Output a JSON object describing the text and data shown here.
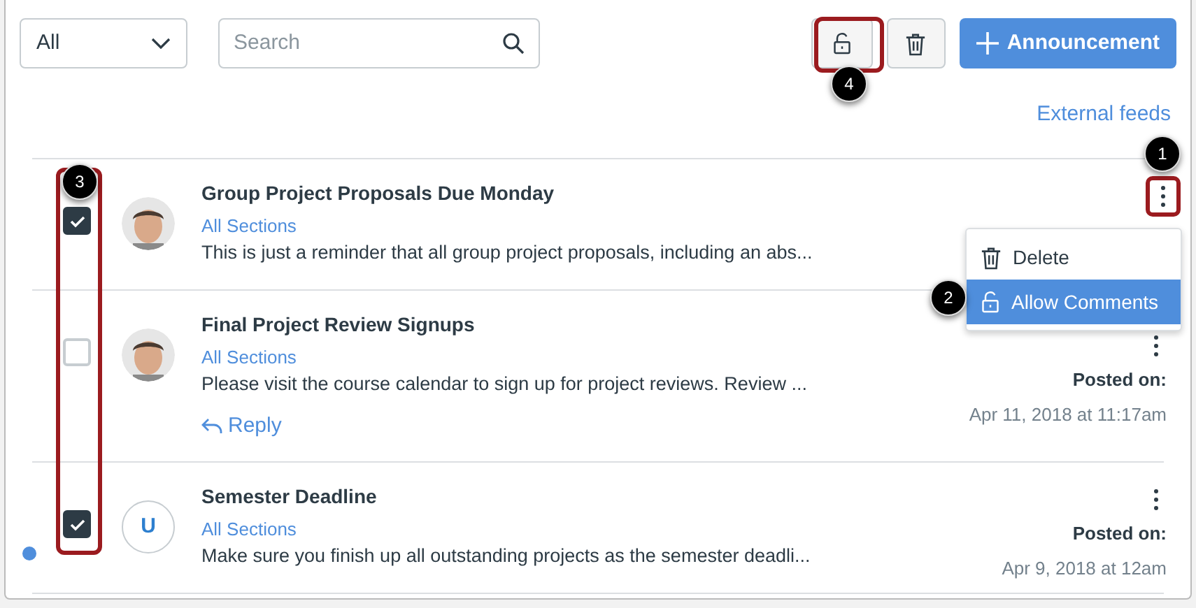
{
  "toolbar": {
    "filter": {
      "value": "All"
    },
    "search": {
      "placeholder": "Search"
    },
    "announcement_button": {
      "label": "Announcement"
    }
  },
  "external_feeds": "External feeds",
  "announcements": [
    {
      "title": "Group Project Proposals Due Monday",
      "section": "All Sections",
      "snippet": "This is just a reminder that all group project proposals, including an abs...",
      "checked": true,
      "unread": false,
      "menu_open": true
    },
    {
      "title": "Final Project Review Signups",
      "section": "All Sections",
      "snippet": "Please visit the course calendar to sign up for project reviews. Review ...",
      "checked": false,
      "unread": false,
      "reply": "Reply",
      "posted_label": "Posted on:",
      "posted_date": "Apr 11, 2018 at 11:17am",
      "menu_open": false
    },
    {
      "title": "Semester Deadline",
      "section": "All Sections",
      "snippet": "Make sure you finish up all outstanding projects as the semester deadli...",
      "checked": true,
      "unread": true,
      "avatar": {
        "kind": "initial",
        "initial": "U"
      },
      "posted_label": "Posted on:",
      "posted_date": "Apr 9, 2018 at 12am",
      "menu_open": false
    }
  ],
  "menu": [
    {
      "kind": "delete",
      "label": "Delete",
      "selected": false
    },
    {
      "kind": "lock",
      "label": "Allow Comments",
      "selected": true
    }
  ],
  "callouts": [
    "1",
    "2",
    "3",
    "4"
  ]
}
